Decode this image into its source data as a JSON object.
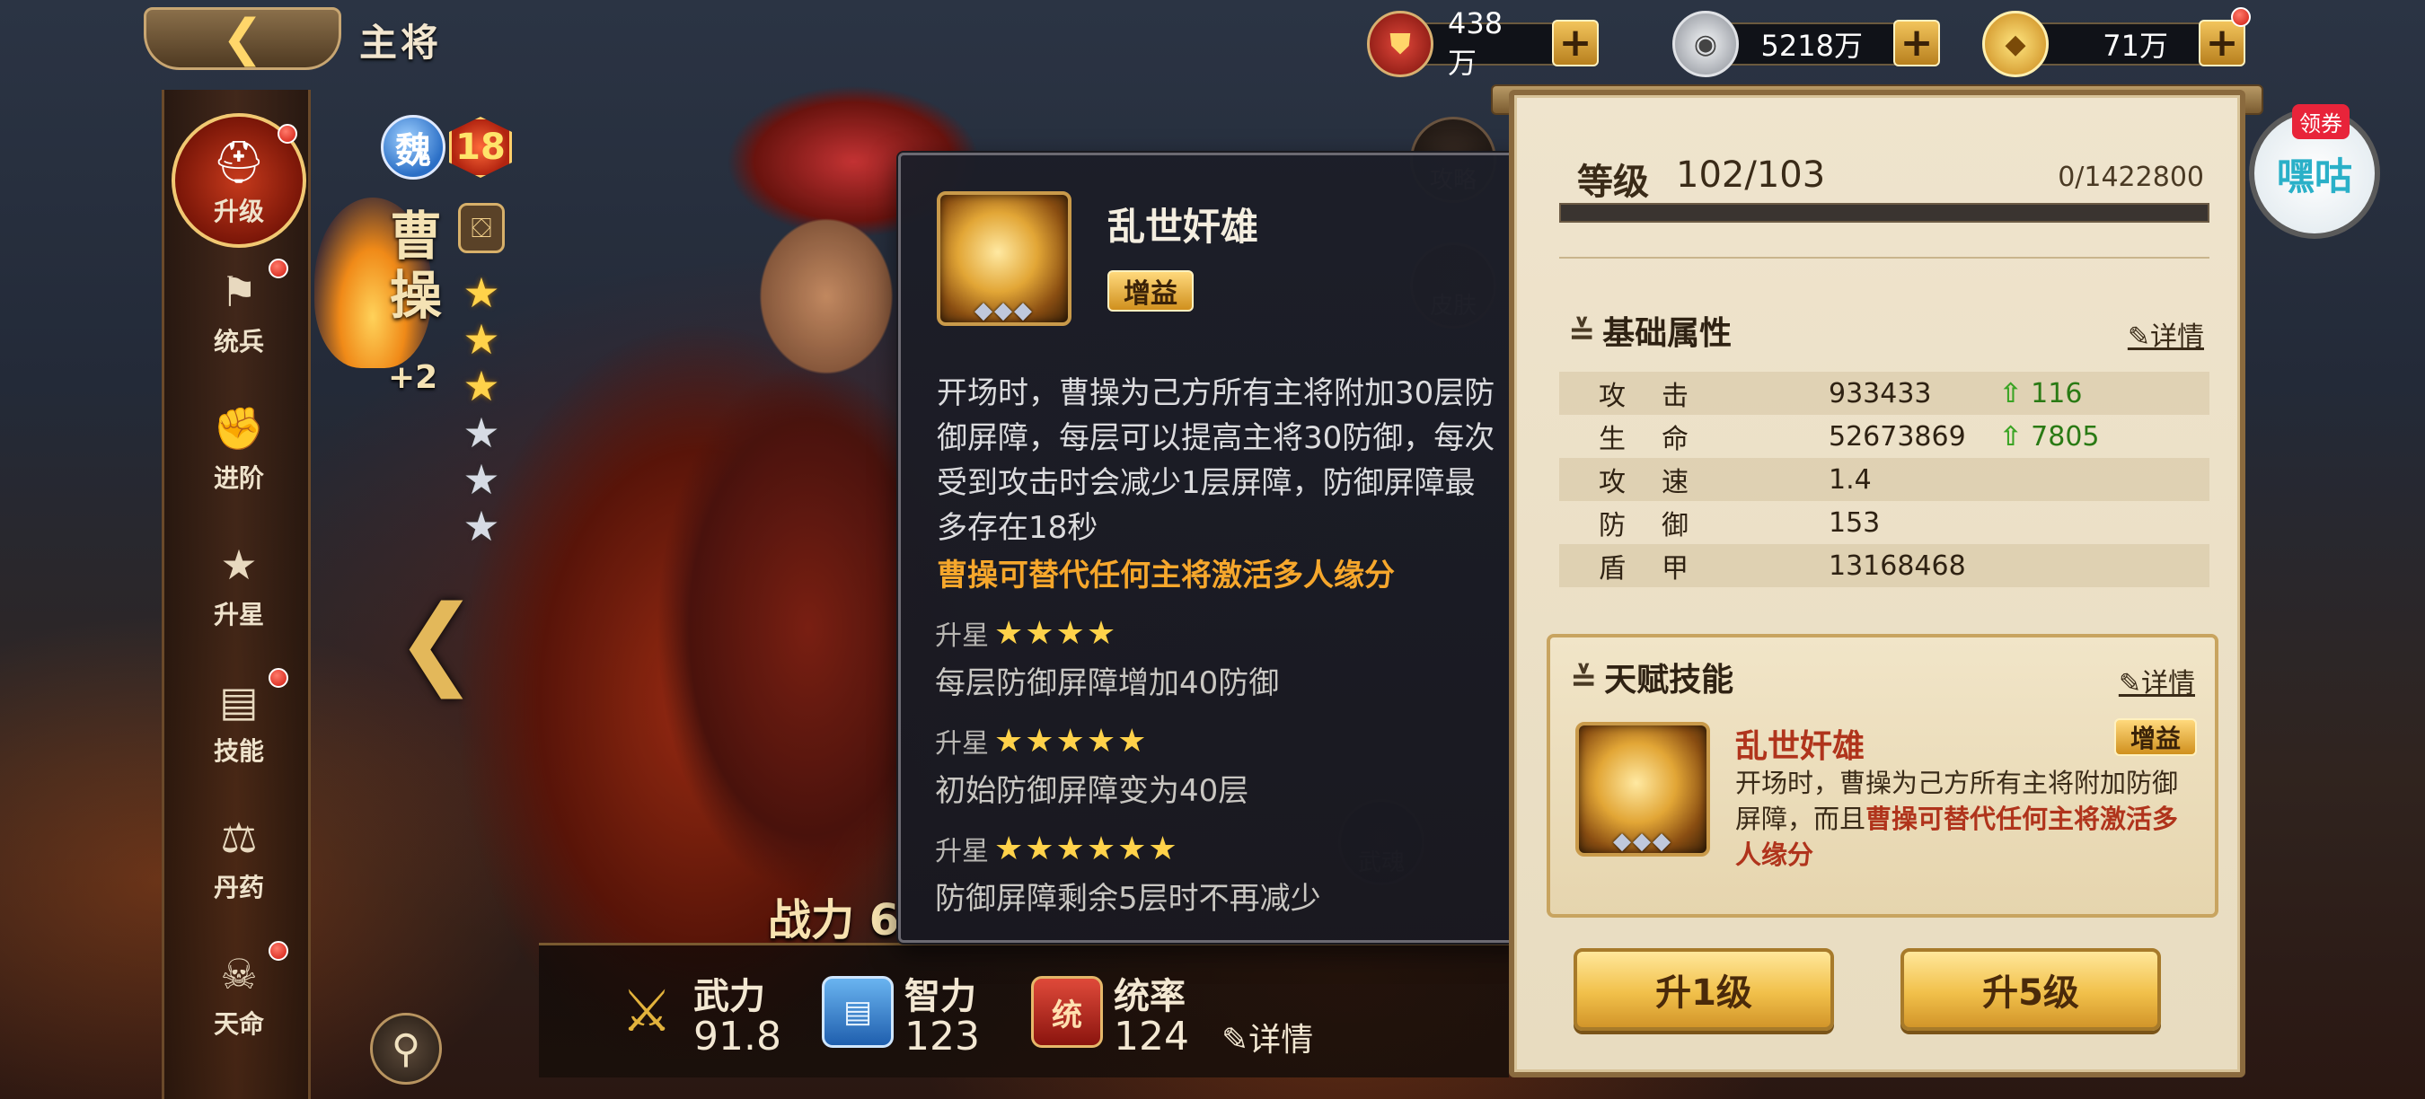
{
  "header": {
    "title": "主将",
    "back_icon": "back-chevron-icon"
  },
  "currencies": [
    {
      "name": "troop-token",
      "value": "438万",
      "icon": "shield-emblem-icon",
      "color": "#b5251a"
    },
    {
      "name": "silver",
      "value": "5218万",
      "icon": "silver-coin-icon",
      "color": "#c9ccd2"
    },
    {
      "name": "gold",
      "value": "71万",
      "icon": "gold-ingot-icon",
      "color": "#f2b53a"
    }
  ],
  "nav": [
    {
      "label": "升级",
      "icon": "helmet-icon",
      "active": true,
      "dot": true
    },
    {
      "label": "统兵",
      "icon": "flag-icon",
      "active": false,
      "dot": true
    },
    {
      "label": "进阶",
      "icon": "fist-up-icon",
      "active": false,
      "dot": false
    },
    {
      "label": "升星",
      "icon": "star-up-icon",
      "active": false,
      "dot": false
    },
    {
      "label": "技能",
      "icon": "book-icon",
      "active": false,
      "dot": true
    },
    {
      "label": "丹药",
      "icon": "potion-icon",
      "active": false,
      "dot": false
    },
    {
      "label": "天命",
      "icon": "skull-icon",
      "active": false,
      "dot": true
    }
  ],
  "hero": {
    "faction": "魏",
    "level": "18",
    "name": "曹操",
    "plus": "+2",
    "stars_gold": 3,
    "stars_total": 6,
    "power_label": "战力",
    "power_value": "6"
  },
  "side_buttons": [
    {
      "label": "攻略",
      "icon": "scroll-icon"
    },
    {
      "label": "皮肤",
      "icon": "shirt-icon"
    },
    {
      "label": "武魂",
      "icon": "soul-icon"
    }
  ],
  "bottom_stats": [
    {
      "label": "武力",
      "value": "91.8",
      "icon": "crossed-swords-icon",
      "color": "#e2b23c"
    },
    {
      "label": "智力",
      "value": "123",
      "icon": "scroll-blue-icon",
      "color": "#3a8ad6"
    },
    {
      "label": "统率",
      "value": "124",
      "icon": "command-shield-icon",
      "color": "#c2282a",
      "badge": "统"
    }
  ],
  "bottom_detail": "详情",
  "tooltip": {
    "name": "乱世奸雄",
    "tag": "增益",
    "description": "开场时，曹操为己方所有主将附加30层防御屏障，每层可以提高主将30防御，每次受到攻击时会减少1层屏障，防御屏障最多存在18秒",
    "highlight": "曹操可替代任何主将激活多人缘分",
    "upgrades": [
      {
        "label": "升星",
        "stars": 4,
        "text": "每层防御屏障增加40防御"
      },
      {
        "label": "升星",
        "stars": 5,
        "text": "初始防御屏障变为40层"
      },
      {
        "label": "升星",
        "stars": 6,
        "text": "防御屏障剩余5层时不再减少"
      }
    ]
  },
  "panel": {
    "level_label": "等级",
    "level_value": "102/103",
    "exp_text": "0/1422800",
    "exp_fraction": 0,
    "base_title": "基础属性",
    "detail_label": "详情",
    "attributes": [
      {
        "name": "攻击",
        "value": "933433",
        "inc": "116"
      },
      {
        "name": "生命",
        "value": "52673869",
        "inc": "7805"
      },
      {
        "name": "攻速",
        "value": "1.4",
        "inc": ""
      },
      {
        "name": "防御",
        "value": "153",
        "inc": ""
      },
      {
        "name": "盾甲",
        "value": "13168468",
        "inc": ""
      }
    ],
    "talent_title": "天赋技能",
    "talent_name": "乱世奸雄",
    "talent_tag": "增益",
    "talent_desc_plain": "开场时，曹操为己方所有主将附加防御屏障，而且",
    "talent_desc_hl": "曹操可替代任何主将激活多人缘分",
    "btn_up1": "升1级",
    "btn_up5": "升5级"
  },
  "floating": {
    "tag": "领券",
    "text": "嘿咕"
  }
}
